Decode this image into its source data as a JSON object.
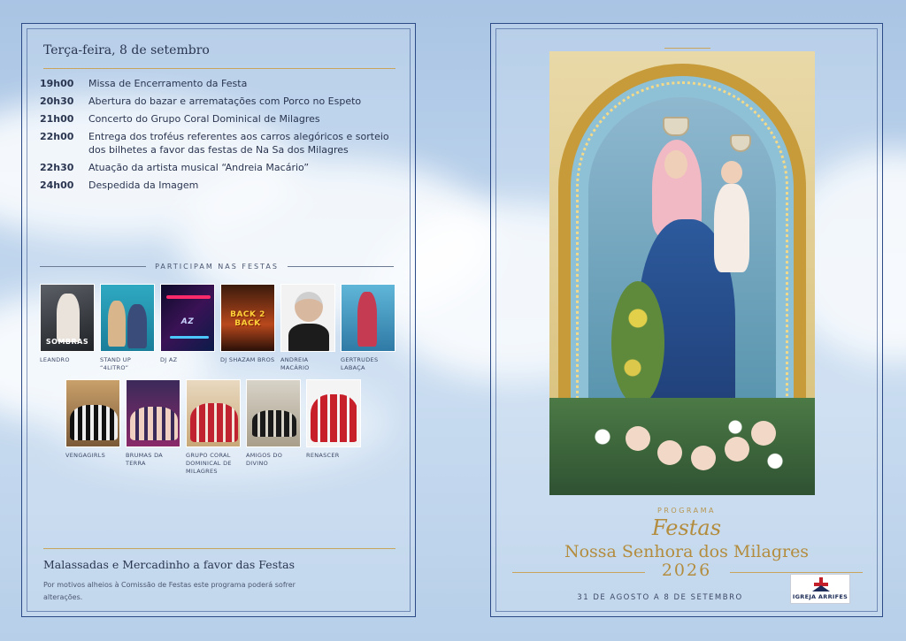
{
  "left": {
    "day_title": "Terça-feira, 8 de setembro",
    "schedule": [
      {
        "time": "19h00",
        "text": "Missa de Encerramento da Festa"
      },
      {
        "time": "20h30",
        "text": "Abertura do bazar e arrematações com Porco no Espeto"
      },
      {
        "time": "21h00",
        "text": "Concerto do Grupo Coral Dominical de Milagres"
      },
      {
        "time": "22h00",
        "text": "Entrega dos troféus referentes aos carros alegóricos e sorteio dos bilhetes a favor das festas de Na Sa dos Milagres"
      },
      {
        "time": "22h30",
        "text": "Atuação da artista musical “Andreia Macário”"
      },
      {
        "time": "24h00",
        "text": "Despedida da Imagem"
      }
    ],
    "participants_heading": "PARTICIPAM NAS FESTAS",
    "participants_row1": [
      {
        "label": "LEANDRO",
        "photo_text": "SOMBRAS"
      },
      {
        "label": "STAND UP “4LITRO”"
      },
      {
        "label": "DJ AZ",
        "photo_text": "AZ"
      },
      {
        "label": "DJ SHAZAM BROS",
        "photo_text": "BACK 2 BACK"
      },
      {
        "label": "ANDREIA MACÁRIO"
      },
      {
        "label": "GERTRUDES LABAÇA"
      }
    ],
    "participants_row2": [
      {
        "label": "VENGAGIRLS"
      },
      {
        "label": "BRUMAS DA TERRA"
      },
      {
        "label": "GRUPO CORAL DOMINICAL DE MILAGRES"
      },
      {
        "label": "AMIGOS DO DIVINO"
      },
      {
        "label": "RENASCER"
      }
    ],
    "footer_title": "Malassadas e Mercadinho a favor das Festas",
    "footer_note": "Por motivos alheios à Comissão de Festas este programa poderá sofrer alterações."
  },
  "right": {
    "programa": "PROGRAMA",
    "festas": "Festas",
    "title": "Nossa Senhora dos Milagres",
    "year": "2026",
    "dates": "31 DE AGOSTO A 8 DE SETEMBRO",
    "logo_text": "IGREJA ARRIFES"
  },
  "colors": {
    "frame": "#2b4a86",
    "gold": "#b38c3e",
    "text": "#2a3550"
  }
}
